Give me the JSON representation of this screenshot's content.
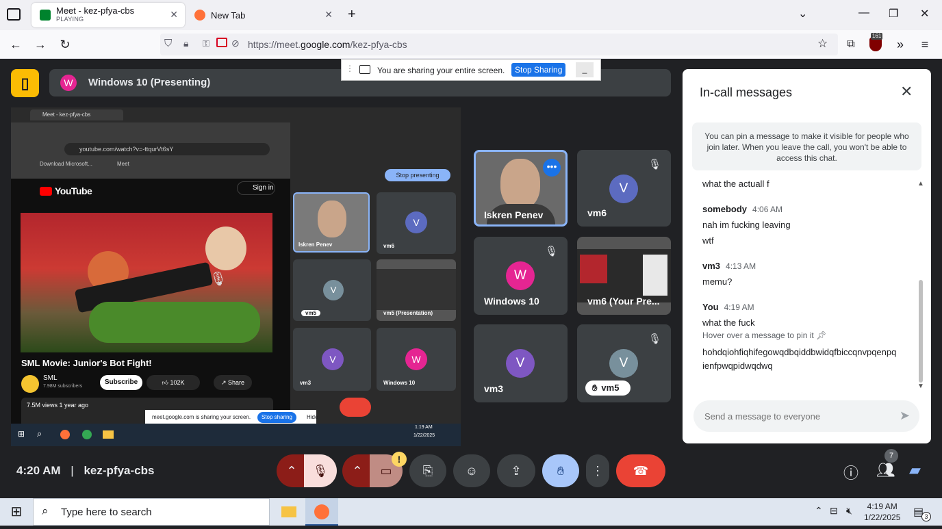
{
  "browser": {
    "tabs": [
      {
        "title": "Meet - kez-pfya-cbs",
        "subtitle": "PLAYING"
      },
      {
        "title": "New Tab",
        "subtitle": ""
      }
    ],
    "url_prefix": "https://meet.",
    "url_domain": "google.com",
    "url_path": "/kez-pfya-cbs",
    "badge_count": "161"
  },
  "meet": {
    "presenting_initial": "W",
    "presenting_title": "Windows 10 (Presenting)",
    "share_banner": {
      "message": "You are sharing your entire screen.",
      "stop_label": "Stop Sharing"
    },
    "shared_screen": {
      "outer_tab": "Meet - kez-pfya-cbs",
      "yt_url": "youtube.com/watch?v=-ttqurVt6sY",
      "bookmark1": "Download Microsoft...",
      "bookmark2": "Meet",
      "yt_logo": "YouTube",
      "sign_in": "Sign in",
      "video_title": "SML Movie: Junior's Bot Fight!",
      "channel": "SML",
      "subscribers": "7.98M subscribers",
      "subscribe": "Subscribe",
      "likes": "102K",
      "share": "Share",
      "views": "7.5M views  1 year ago",
      "stop_presenting": "Stop presenting",
      "inner_tiles": [
        "Iskren Penev",
        "vm6",
        "vm5",
        "vm5 (Presentation)",
        "vm3",
        "Windows 10"
      ],
      "inner_share_msg": "meet.google.com is sharing your screen.",
      "inner_stop": "Stop sharing",
      "inner_hide": "Hide",
      "mini_time": "1:19 AM",
      "mini_date": "1/22/2025"
    },
    "tiles": [
      {
        "name": "Iskren Penev",
        "initial": "",
        "color": ""
      },
      {
        "name": "vm6",
        "initial": "V",
        "color": "#5c6bc0"
      },
      {
        "name": "Windows 10",
        "initial": "W",
        "color": "#e52592"
      },
      {
        "name": "vm6 (Your Pre...",
        "initial": "",
        "color": ""
      },
      {
        "name": "vm3",
        "initial": "V",
        "color": "#7e57c2"
      },
      {
        "name": "vm5",
        "initial": "V",
        "color": "#78909c"
      }
    ],
    "time": "4:20 AM",
    "meeting_code": "kez-pfya-cbs",
    "people_count": "7"
  },
  "chat": {
    "title": "In-call messages",
    "pin_note": "You can pin a message to make it visible for people who join later. When you leave the call, you won't be able to access this chat.",
    "messages": [
      {
        "sender": "",
        "time": "",
        "lines": [
          "what the actuall f"
        ]
      },
      {
        "sender": "somebody",
        "time": "4:06 AM",
        "lines": [
          "nah im fucking leaving",
          "wtf"
        ]
      },
      {
        "sender": "vm3",
        "time": "4:13 AM",
        "lines": [
          "memu?"
        ]
      },
      {
        "sender": "You",
        "time": "4:19 AM",
        "lines": [
          "what the fuck"
        ]
      }
    ],
    "hover_hint": "Hover over a message to pin it",
    "last_message": "hohdqiohfiqhifegowqdbqiddbwidqfbiccqnvpqenpqienfpwqpidwqdwq",
    "placeholder": "Send a message to everyone"
  },
  "taskbar": {
    "search_placeholder": "Type here to search",
    "time": "4:19 AM",
    "date": "1/22/2025",
    "notification_count": "3"
  }
}
